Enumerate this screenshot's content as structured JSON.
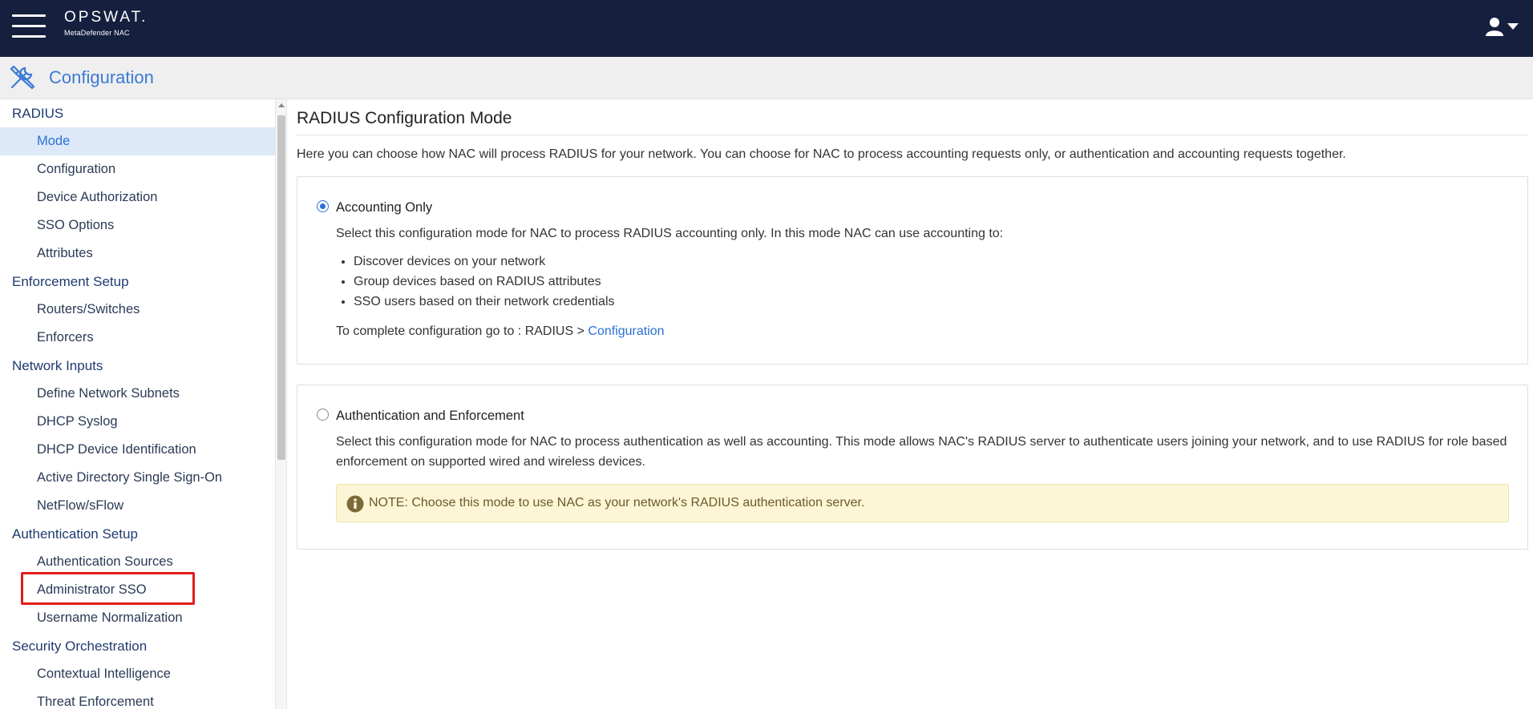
{
  "topbar": {
    "brand_name": "OPSWAT.",
    "brand_sub": "MetaDefender NAC"
  },
  "header": {
    "title": "Configuration",
    "icon": "tools-icon"
  },
  "sidebar": {
    "sections": [
      {
        "title": "RADIUS",
        "items": [
          "Mode",
          "Configuration",
          "Device Authorization",
          "SSO Options",
          "Attributes"
        ]
      },
      {
        "title": "Enforcement Setup",
        "items": [
          "Routers/Switches",
          "Enforcers"
        ]
      },
      {
        "title": "Network Inputs",
        "items": [
          "Define Network Subnets",
          "DHCP Syslog",
          "DHCP Device Identification",
          "Active Directory Single Sign-On",
          "NetFlow/sFlow"
        ]
      },
      {
        "title": "Authentication Setup",
        "items": [
          "Authentication Sources",
          "Administrator SSO",
          "Username Normalization"
        ]
      },
      {
        "title": "Security Orchestration",
        "items": [
          "Contextual Intelligence",
          "Threat Enforcement"
        ]
      }
    ],
    "active_item": "Mode"
  },
  "main": {
    "title": "RADIUS Configuration Mode",
    "description": "Here you can choose how NAC will process RADIUS for your network. You can choose for NAC to process accounting requests only, or authentication and accounting requests together.",
    "option1": {
      "title": "Accounting Only",
      "selected": true,
      "text": "Select this configuration mode for NAC to process RADIUS accounting only. In this mode NAC can use accounting to:",
      "bullets": [
        "Discover devices on your network",
        "Group devices based on RADIUS attributes",
        "SSO users based on their network credentials"
      ],
      "footer_prefix": "To complete configuration go to : RADIUS > ",
      "footer_link": "Configuration"
    },
    "option2": {
      "title": "Authentication and Enforcement",
      "selected": false,
      "text": "Select this configuration mode for NAC to process authentication as well as accounting. This mode allows NAC's RADIUS server to authenticate users joining your network, and to use RADIUS for role based enforcement on supported wired and wireless devices.",
      "note": "NOTE: Choose this mode to use NAC as your network's RADIUS authentication server."
    }
  },
  "colors": {
    "topbar": "#15203f",
    "accent": "#2b6fd6",
    "highlight": "#e31b1b"
  }
}
